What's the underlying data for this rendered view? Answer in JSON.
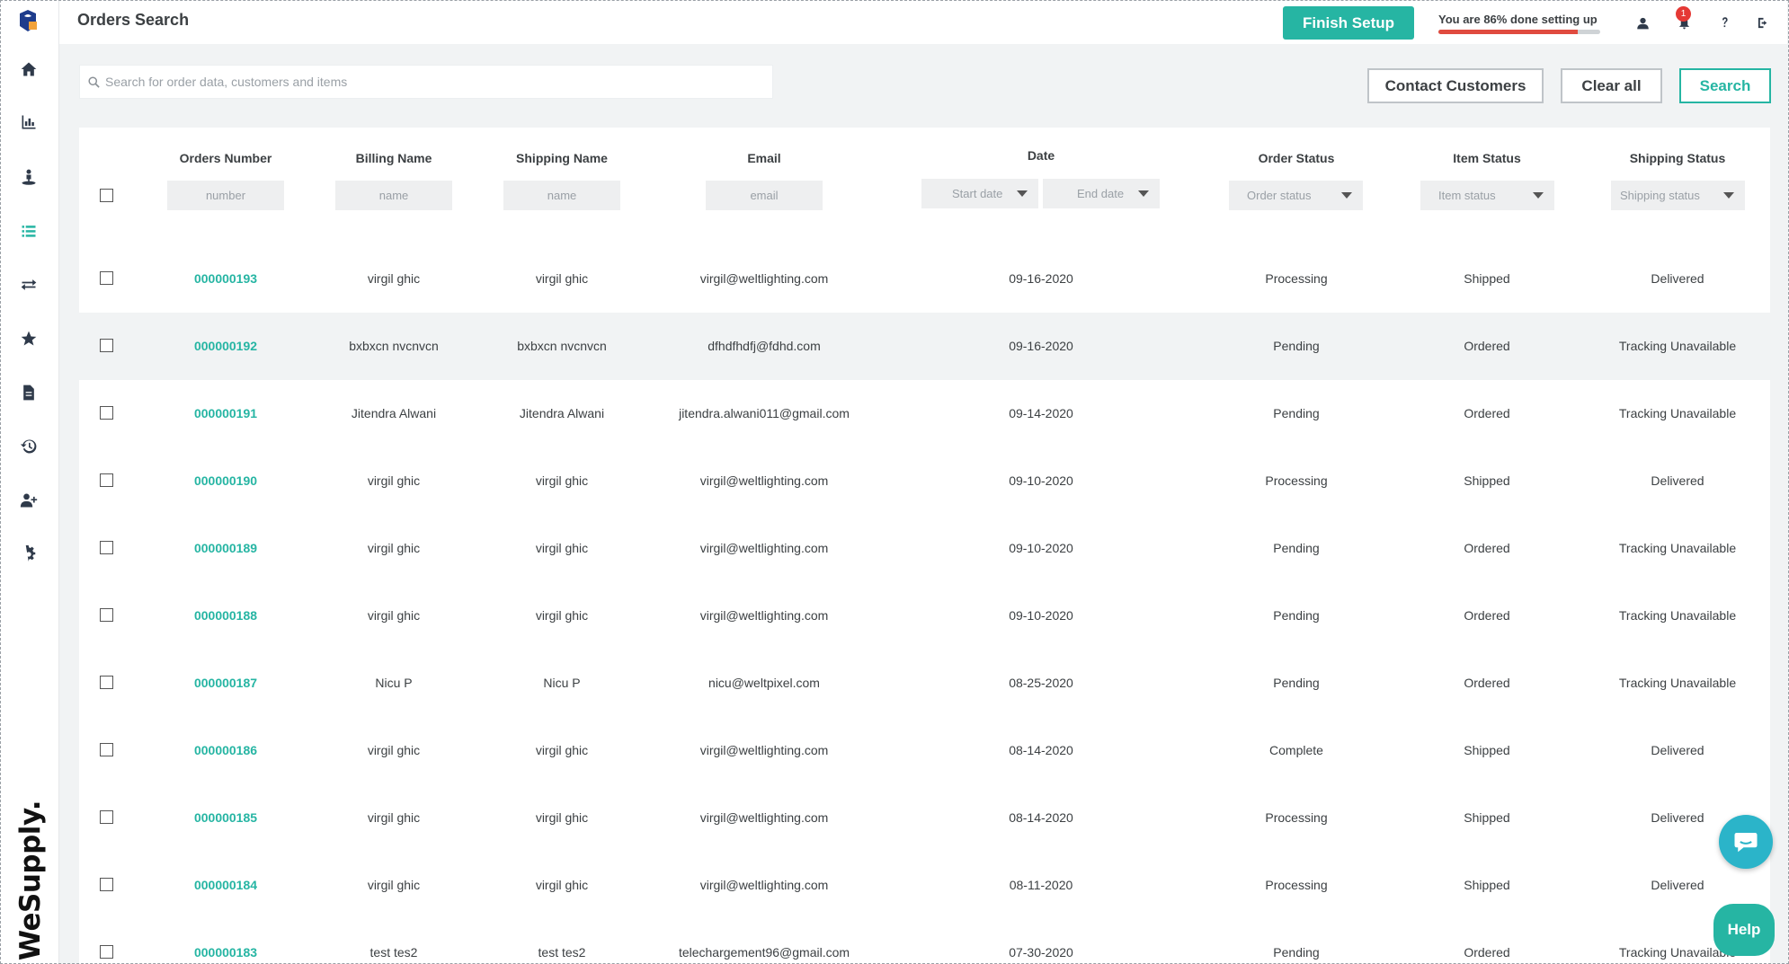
{
  "brand": {
    "wordmark": "WeSupply."
  },
  "header": {
    "title": "Orders Search",
    "finish_setup_label": "Finish Setup",
    "progress_text": "You are 86% done setting up",
    "progress_percent": 86,
    "notification_count": "1",
    "icons": [
      "user-icon",
      "bell-icon",
      "help-icon",
      "logout-icon"
    ]
  },
  "sidebar": {
    "items": [
      {
        "icon": "home-icon"
      },
      {
        "icon": "bar-chart-icon"
      },
      {
        "icon": "person-pin-icon"
      },
      {
        "icon": "list-icon",
        "active": true
      },
      {
        "icon": "exchange-icon"
      },
      {
        "icon": "star-icon"
      },
      {
        "icon": "document-icon"
      },
      {
        "icon": "history-icon"
      },
      {
        "icon": "add-user-icon"
      },
      {
        "icon": "gear-icon"
      }
    ]
  },
  "search": {
    "placeholder": "Search for order data, customers and items",
    "contact_label": "Contact Customers",
    "clear_label": "Clear all",
    "search_label": "Search"
  },
  "table": {
    "headers": {
      "order_number": "Orders Number",
      "billing_name": "Billing Name",
      "shipping_name": "Shipping Name",
      "email": "Email",
      "date": "Date",
      "order_status": "Order Status",
      "item_status": "Item Status",
      "shipping_status": "Shipping Status"
    },
    "filters": {
      "number": "number",
      "billing": "name",
      "shipping": "name",
      "email": "email",
      "start_date": "Start date",
      "end_date": "End date",
      "order_status": "Order status",
      "item_status": "Item status",
      "shipping_status": "Shipping status"
    },
    "rows": [
      {
        "order": "000000193",
        "billing": "virgil ghic",
        "shipping": "virgil ghic",
        "email": "virgil@weltlighting.com",
        "date": "09-16-2020",
        "order_status": "Processing",
        "item_status": "Shipped",
        "shipping_status": "Delivered"
      },
      {
        "order": "000000192",
        "billing": "bxbxcn nvcnvcn",
        "shipping": "bxbxcn nvcnvcn",
        "email": "dfhdfhdfj@fdhd.com",
        "date": "09-16-2020",
        "order_status": "Pending",
        "item_status": "Ordered",
        "shipping_status": "Tracking Unavailable"
      },
      {
        "order": "000000191",
        "billing": "Jitendra Alwani",
        "shipping": "Jitendra Alwani",
        "email": "jitendra.alwani011@gmail.com",
        "date": "09-14-2020",
        "order_status": "Pending",
        "item_status": "Ordered",
        "shipping_status": "Tracking Unavailable"
      },
      {
        "order": "000000190",
        "billing": "virgil ghic",
        "shipping": "virgil ghic",
        "email": "virgil@weltlighting.com",
        "date": "09-10-2020",
        "order_status": "Processing",
        "item_status": "Shipped",
        "shipping_status": "Delivered"
      },
      {
        "order": "000000189",
        "billing": "virgil ghic",
        "shipping": "virgil ghic",
        "email": "virgil@weltlighting.com",
        "date": "09-10-2020",
        "order_status": "Pending",
        "item_status": "Ordered",
        "shipping_status": "Tracking Unavailable"
      },
      {
        "order": "000000188",
        "billing": "virgil ghic",
        "shipping": "virgil ghic",
        "email": "virgil@weltlighting.com",
        "date": "09-10-2020",
        "order_status": "Pending",
        "item_status": "Ordered",
        "shipping_status": "Tracking Unavailable"
      },
      {
        "order": "000000187",
        "billing": "Nicu P",
        "shipping": "Nicu P",
        "email": "nicu@weltpixel.com",
        "date": "08-25-2020",
        "order_status": "Pending",
        "item_status": "Ordered",
        "shipping_status": "Tracking Unavailable"
      },
      {
        "order": "000000186",
        "billing": "virgil ghic",
        "shipping": "virgil ghic",
        "email": "virgil@weltlighting.com",
        "date": "08-14-2020",
        "order_status": "Complete",
        "item_status": "Shipped",
        "shipping_status": "Delivered"
      },
      {
        "order": "000000185",
        "billing": "virgil ghic",
        "shipping": "virgil ghic",
        "email": "virgil@weltlighting.com",
        "date": "08-14-2020",
        "order_status": "Processing",
        "item_status": "Shipped",
        "shipping_status": "Delivered"
      },
      {
        "order": "000000184",
        "billing": "virgil ghic",
        "shipping": "virgil ghic",
        "email": "virgil@weltlighting.com",
        "date": "08-11-2020",
        "order_status": "Processing",
        "item_status": "Shipped",
        "shipping_status": "Delivered"
      },
      {
        "order": "000000183",
        "billing": "test tes2",
        "shipping": "test tes2",
        "email": "telechargement96@gmail.com",
        "date": "07-30-2020",
        "order_status": "Pending",
        "item_status": "Ordered",
        "shipping_status": "Tracking Unavailable"
      }
    ]
  },
  "floating": {
    "help_label": "Help"
  },
  "colors": {
    "accent": "#26b5a3",
    "progress": "#e04b3f",
    "chat": "#2bb4c9"
  }
}
